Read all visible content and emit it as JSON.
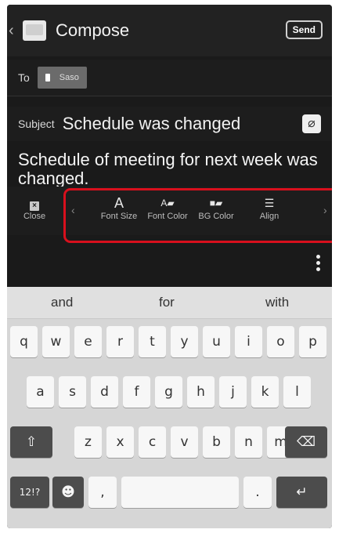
{
  "header": {
    "back_glyph": "‹",
    "title": "Compose",
    "send_label": "Send"
  },
  "to_row": {
    "label": "To",
    "recipient": "Saso"
  },
  "subject_row": {
    "label": "Subject",
    "value": "Schedule was changed"
  },
  "message": {
    "body": "Schedule of meeting for next week was changed."
  },
  "format_toolbar": {
    "items": [
      {
        "label": "Close",
        "icon": "close-icon"
      },
      {
        "label": "Font Size",
        "icon": "font-size-icon"
      },
      {
        "label": "Font Color",
        "icon": "font-color-icon"
      },
      {
        "label": "BG Color",
        "icon": "bg-color-icon"
      },
      {
        "label": "Align",
        "icon": "align-icon"
      }
    ],
    "highlight_color": "#d8101d"
  },
  "keyboard": {
    "suggestions": [
      "and",
      "for",
      "with"
    ],
    "row1": [
      "q",
      "w",
      "e",
      "r",
      "t",
      "y",
      "u",
      "i",
      "o",
      "p"
    ],
    "row2": [
      "a",
      "s",
      "d",
      "f",
      "g",
      "h",
      "j",
      "k",
      "l"
    ],
    "row3": [
      "z",
      "x",
      "c",
      "v",
      "b",
      "n",
      "m"
    ],
    "symbols_label": "12!?",
    "comma": ",",
    "period": "."
  }
}
